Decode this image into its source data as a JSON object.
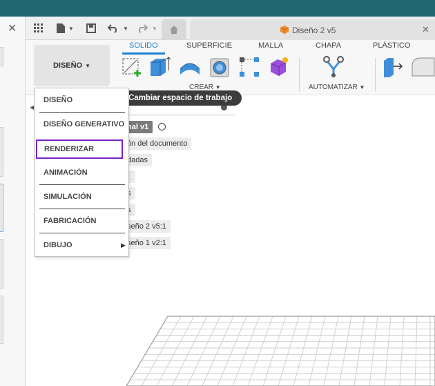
{
  "window": {
    "close_glyph": "✕"
  },
  "toolbar": {
    "apps_icon": "grid-icon",
    "file_icon": "file-icon",
    "save_icon": "save-icon",
    "undo_icon": "undo-icon",
    "redo_icon": "redo-icon",
    "home_icon": "home-icon",
    "doc_title": "Diseño 2 v5",
    "doc_close": "✕"
  },
  "ribbon": {
    "workspace_label": "DISEÑO",
    "tabs": [
      "SOLIDO",
      "SUPERFICIE",
      "MALLA",
      "CHAPA",
      "PLÁSTICO"
    ],
    "active_tab": "SOLIDO",
    "groups": {
      "create": "CREAR",
      "automate": "AUTOMATIZAR"
    },
    "accent": "#1a82d4"
  },
  "tooltip": {
    "text": "Cambiar espacio de trabajo"
  },
  "browser": {
    "items": [
      "nal v1",
      "ón del documento",
      "dadas",
      "s",
      "s",
      "seño 2 v5:1",
      "seño 1 v2:1"
    ]
  },
  "workspace_menu": {
    "items": [
      "DISEÑO",
      "DISEÑO GENERATIVO",
      "RENDERIZAR",
      "ANIMACIÓN",
      "SIMULACIÓN",
      "FABRICACIÓN",
      "DIBUJO"
    ],
    "selected": "RENDERIZAR",
    "selected_color": "#7a22cc",
    "submenu_arrow": "▶"
  },
  "colors": {
    "titlebar": "#1f6671",
    "menu_highlight": "#7a22cc"
  }
}
